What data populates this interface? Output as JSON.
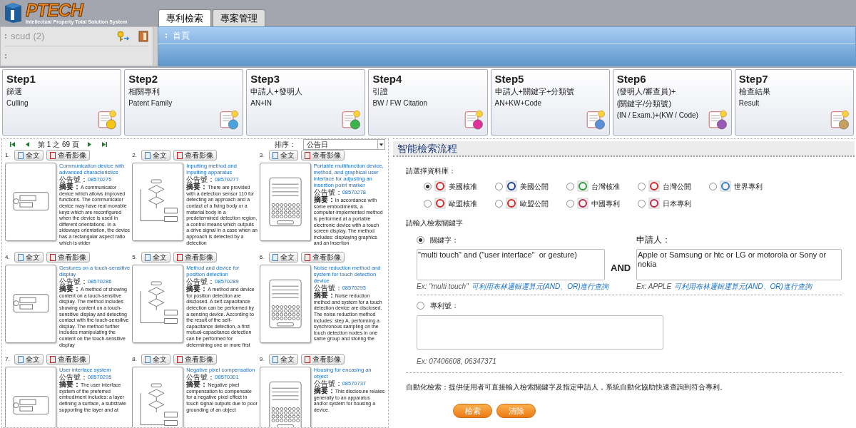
{
  "header": {
    "logo_text": "PTECH",
    "logo_subtitle": "Intellectual Property Total Solution System",
    "tabs": [
      {
        "label": "專利檢索",
        "selected": true
      },
      {
        "label": "專案管理",
        "selected": false
      }
    ]
  },
  "user_panel": {
    "username": "scud",
    "count": "(2)"
  },
  "breadcrumb": "首頁",
  "steps": [
    {
      "step": "Step1",
      "title": [
        "篩選"
      ],
      "subtitle": "Culling"
    },
    {
      "step": "Step2",
      "title": [
        "相關專利"
      ],
      "subtitle": "Patent Family"
    },
    {
      "step": "Step3",
      "title": [
        "申請人+發明人"
      ],
      "subtitle": "AN+IN"
    },
    {
      "step": "Step4",
      "title": [
        "引證"
      ],
      "subtitle": "BW / FW Citation"
    },
    {
      "step": "Step5",
      "title": [
        "申請人+關鍵字+分類號"
      ],
      "subtitle": "AN+KW+Code"
    },
    {
      "step": "Step6",
      "title": [
        "(發明人/審查員)+",
        "(關鍵字/分類號)"
      ],
      "subtitle": "(IN / Exam.)+(KW / Code)"
    },
    {
      "step": "Step7",
      "title": [
        "檢查結果"
      ],
      "subtitle": "Result"
    }
  ],
  "results": {
    "page_text": "第 1 之 69 頁",
    "sort_label": "排序：",
    "sort_value": "公告日",
    "items": [
      {
        "number": "1.",
        "buttons": [
          "全文",
          "查看影像"
        ],
        "title": "Communication device with advanced characteristics",
        "pub_label": "公告號：",
        "pub_number": "08570275",
        "abstract_label": "摘要：",
        "abstract": "A communicator device which allows improved functions. The communicator device may have real movable keys which are reconfigured when the device is used in different orientations. In a sideways orientation, the device has a rectangular aspect ratio which is wider"
      },
      {
        "number": "2.",
        "buttons": [
          "全文",
          "查看影像"
        ],
        "title": "Inputting method and inputting apparatus",
        "pub_label": "公告號：",
        "pub_number": "08570277",
        "abstract_label": "摘要：",
        "abstract": "There are provided with a detection sensor 110 for detecting an approach and a contact of a living body or a material body in a predetermined detection region, a control means which outputs a drive signal in a case when an approach is detected by a detection"
      },
      {
        "number": "3.",
        "buttons": [
          "全文",
          "查看影像"
        ],
        "title": "Portable multifunction device, method, and graphical user interface for adjusting an insertion point marker",
        "pub_label": "公告號：",
        "pub_number": "08570278",
        "abstract_label": "摘要：",
        "abstract": "In accordance with some embodiments, a computer-implemented method is performed at a portable electronic device with a touch screen display. The method includes: displaying graphics and an insertion"
      },
      {
        "number": "4.",
        "buttons": [
          "全文",
          "查看影像"
        ],
        "title": "Gestures on a touch-sensitive display",
        "pub_label": "公告號：",
        "pub_number": "08570286",
        "abstract_label": "摘要：",
        "abstract": "A method of showing content on a touch-sensitive display. The method includes showing content on a touch-sensitive display and detecting contact with the touch-sensitive display. The method further includes manipulating the content on the touch-sensitive display"
      },
      {
        "number": "5.",
        "buttons": [
          "全文",
          "查看影像"
        ],
        "title": "Method and device for position detection",
        "pub_label": "公告號：",
        "pub_number": "08570289",
        "abstract_label": "摘要：",
        "abstract": "A method and device for position detection are disclosed. A self-capacitance detection can be performed by a sensing device. According to the result of the self-capacitance detection, a first mutual-capacitance detection can be performed for determining one or more first"
      },
      {
        "number": "6.",
        "buttons": [
          "全文",
          "查看影像"
        ],
        "title": "Noise reduction method and system for touch detection device",
        "pub_label": "公告號：",
        "pub_number": "08570293",
        "abstract_label": "摘要：",
        "abstract": "Noise reduction method and system for a touch detection device are disclosed. The noise reduction method includes: step A, performing a synchronous sampling on the touch detection nodes in one same group and storing the"
      },
      {
        "number": "7.",
        "buttons": [
          "全文",
          "查看影像"
        ],
        "title": "User interface system",
        "pub_label": "公告號：",
        "pub_number": "08570295",
        "abstract_label": "摘要：",
        "abstract": "The user interface system of the preferred embodiment includes: a layer defining a surface, a substrate supporting the layer and at"
      },
      {
        "number": "8.",
        "buttons": [
          "全文",
          "查看影像"
        ],
        "title": "Negative pixel compensation",
        "pub_label": "公告號：",
        "pub_number": "08570301",
        "abstract_label": "摘要：",
        "abstract": "Negative pixel compensation to compensate for a negative pixel effect in touch signal outputs due to poor grounding of an object"
      },
      {
        "number": "9.",
        "buttons": [
          "全文",
          "查看影像"
        ],
        "title": "Housing for encasing an object",
        "pub_label": "公告號：",
        "pub_number": "08570737",
        "abstract_label": "摘要：",
        "abstract": "This disclosure relates generally to an apparatus and/or system for housing a device."
      }
    ]
  },
  "search": {
    "title": "智能檢索流程",
    "db_label": "請選擇資料庫：",
    "databases": [
      {
        "label": "美國核准",
        "selected": true
      },
      {
        "label": "美國公開",
        "selected": false
      },
      {
        "label": "台灣核准",
        "selected": false
      },
      {
        "label": "台灣公開",
        "selected": false
      },
      {
        "label": "世界專利",
        "selected": false
      },
      {
        "label": "歐盟核准",
        "selected": false
      },
      {
        "label": "歐盟公開",
        "selected": false
      },
      {
        "label": "中國專利",
        "selected": false
      },
      {
        "label": "日本專利",
        "selected": false
      }
    ],
    "keyword_prompt": "請輸入檢索關鍵字",
    "keyword": {
      "label": "關鍵字：",
      "selected": true,
      "value": "\"multi touch\" and (\"user interface\"  or gesture)",
      "hint_ex": "Ex: \"multi touch\"",
      "hint_note": "可利用布林邏輯運算元(AND、OR)進行查詢"
    },
    "operator": "AND",
    "applicant": {
      "label": "申請人：",
      "value": "Apple or Samsung or htc or LG or motorola or Sony or nokia",
      "hint_ex": "Ex: APPLE",
      "hint_note": "可利用布林邏輯運算元(AND、OR)進行查詢"
    },
    "patent_number": {
      "label": "專利號：",
      "selected": false,
      "hint_ex": "Ex: 07406608, 06347371"
    },
    "note": "自動化檢索：提供使用者可直接輸入檢索關鍵字及指定申請人，系統自動化協助快速查詢到符合專利。",
    "buttons": [
      "檢索",
      "清除"
    ]
  }
}
